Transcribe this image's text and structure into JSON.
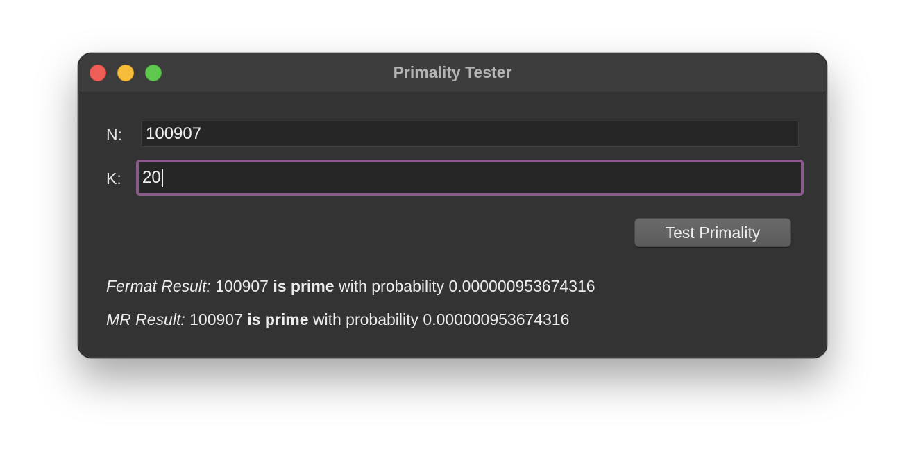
{
  "window": {
    "title": "Primality Tester"
  },
  "form": {
    "n_label": "N:",
    "n_value": "100907",
    "k_label": "K:",
    "k_value": "20",
    "test_button_label": "Test Primality",
    "focus_color": "#8a5a8a"
  },
  "results": {
    "fermat": {
      "label": "Fermat Result:",
      "number": "100907",
      "verdict": "is prime",
      "phrase": "with probability",
      "probability": "0.000000953674316"
    },
    "mr": {
      "label": "MR Result:",
      "number": "100907",
      "verdict": "is prime",
      "phrase": "with probability",
      "probability": "0.000000953674316"
    }
  }
}
